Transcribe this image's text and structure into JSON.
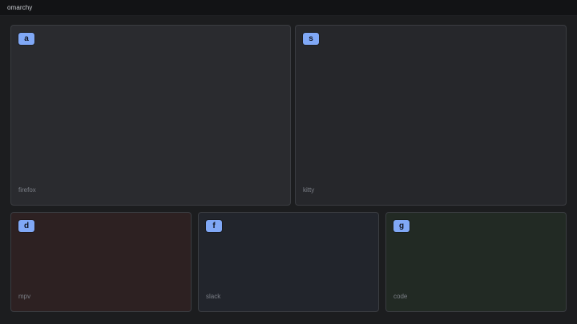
{
  "topbar": {
    "title": "omarchy"
  },
  "windows": [
    {
      "hint": "a",
      "app": "firefox",
      "color": "#2a2b2f"
    },
    {
      "hint": "s",
      "app": "kitty",
      "color": "#26272b"
    },
    {
      "hint": "d",
      "app": "mpv",
      "color": "#2d2122"
    },
    {
      "hint": "f",
      "app": "slack",
      "color": "#22252c"
    },
    {
      "hint": "g",
      "app": "code",
      "color": "#222a24"
    }
  ],
  "colors": {
    "hint_badge": "#80a8f6",
    "background": "#1c1d1f",
    "topbar": "#121315"
  }
}
